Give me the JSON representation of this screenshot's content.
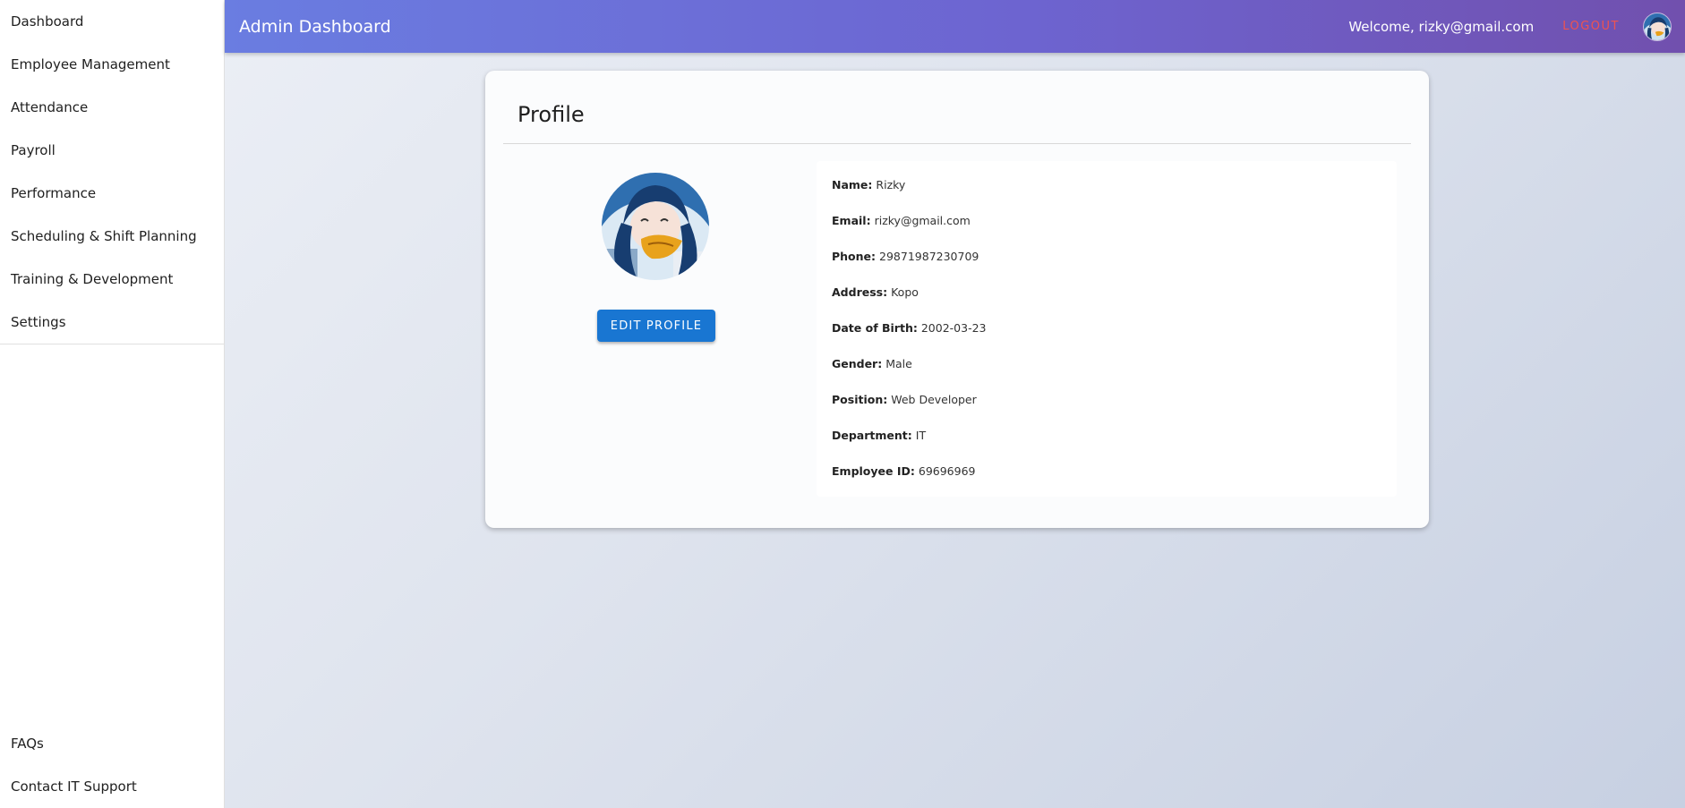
{
  "sidebar": {
    "items": [
      {
        "label": "Dashboard"
      },
      {
        "label": "Employee Management"
      },
      {
        "label": "Attendance"
      },
      {
        "label": "Payroll"
      },
      {
        "label": "Performance"
      },
      {
        "label": "Scheduling & Shift Planning"
      },
      {
        "label": "Training & Development"
      },
      {
        "label": "Settings"
      }
    ],
    "bottom_items": [
      {
        "label": "FAQs"
      },
      {
        "label": "Contact IT Support"
      }
    ]
  },
  "header": {
    "title": "Admin Dashboard",
    "welcome": "Welcome, rizky@gmail.com",
    "logout_label": "LOGOUT"
  },
  "profile": {
    "title": "Profile",
    "edit_label": "EDIT PROFILE",
    "fields": [
      {
        "label": "Name:",
        "value": "Rizky"
      },
      {
        "label": "Email:",
        "value": "rizky@gmail.com"
      },
      {
        "label": "Phone:",
        "value": "29871987230709"
      },
      {
        "label": "Address:",
        "value": "Kopo"
      },
      {
        "label": "Date of Birth:",
        "value": "2002-03-23"
      },
      {
        "label": "Gender:",
        "value": "Male"
      },
      {
        "label": "Position:",
        "value": "Web Developer"
      },
      {
        "label": "Department:",
        "value": "IT"
      },
      {
        "label": "Employee ID:",
        "value": "69696969"
      }
    ]
  },
  "colors": {
    "header_start": "#6a7de1",
    "header_end": "#7150ae",
    "logout": "#ef5350",
    "button": "#1976d2"
  }
}
